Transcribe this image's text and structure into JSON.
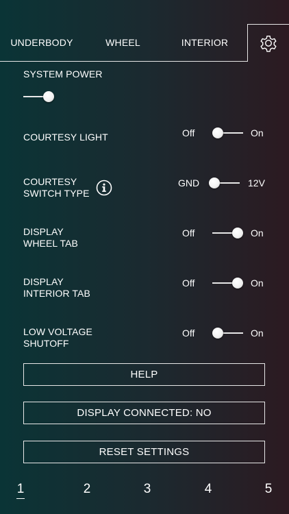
{
  "tabs": {
    "underbody": "UNDERBODY",
    "wheel": "WHEEL",
    "interior": "INTERIOR",
    "settings_icon": "gear-icon"
  },
  "settings": {
    "system_power": {
      "label": "SYSTEM POWER",
      "state": "on"
    },
    "courtesy_light": {
      "label": "COURTESY LIGHT",
      "off": "Off",
      "on": "On",
      "state": "off"
    },
    "courtesy_switch_type": {
      "label_line1": "COURTESY",
      "label_line2": "SWITCH TYPE",
      "off": "GND",
      "on": "12V",
      "state": "off",
      "info_icon": "info-icon"
    },
    "display_wheel_tab": {
      "label_line1": "DISPLAY",
      "label_line2": "WHEEL TAB",
      "off": "Off",
      "on": "On",
      "state": "on"
    },
    "display_interior_tab": {
      "label_line1": "DISPLAY",
      "label_line2": "INTERIOR TAB",
      "off": "Off",
      "on": "On",
      "state": "on"
    },
    "low_voltage_shutoff": {
      "label_line1": "LOW VOLTAGE",
      "label_line2": "SHUTOFF",
      "off": "Off",
      "on": "On",
      "state": "off"
    }
  },
  "buttons": {
    "help": "HELP",
    "display_connected": "DISPLAY CONNECTED: NO",
    "reset": "RESET SETTINGS"
  },
  "pager": {
    "pages": [
      "1",
      "2",
      "3",
      "4",
      "5"
    ],
    "active": "1"
  },
  "colors": {
    "background_left": "#0a3436",
    "background_right": "#2c1a21",
    "foreground": "#ffffff",
    "line": "#e8e8e8"
  }
}
